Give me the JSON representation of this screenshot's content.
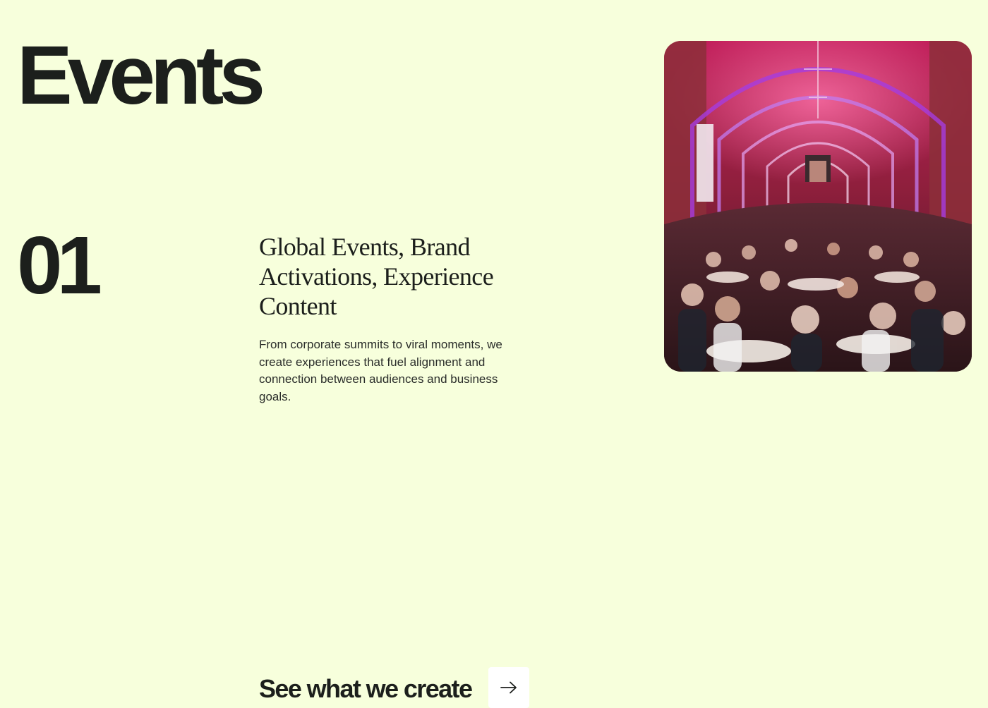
{
  "page": {
    "title": "Events"
  },
  "section": {
    "number": "01",
    "heading": "Global Events, Brand Activations, Experience Content",
    "body": "From corporate summits to viral moments, we create experiences that fuel alignment and connection between audiences and business goals."
  },
  "hero_image": {
    "subject": "banquet hall with brick arches lit in magenta and purple, guests seated at round tables"
  },
  "cta": {
    "label": "See what we create",
    "icon": "arrow-right-icon"
  },
  "colors": {
    "background": "#F7FFDC",
    "text": "#1C1F1C",
    "button_bg": "#FFFFFF"
  }
}
